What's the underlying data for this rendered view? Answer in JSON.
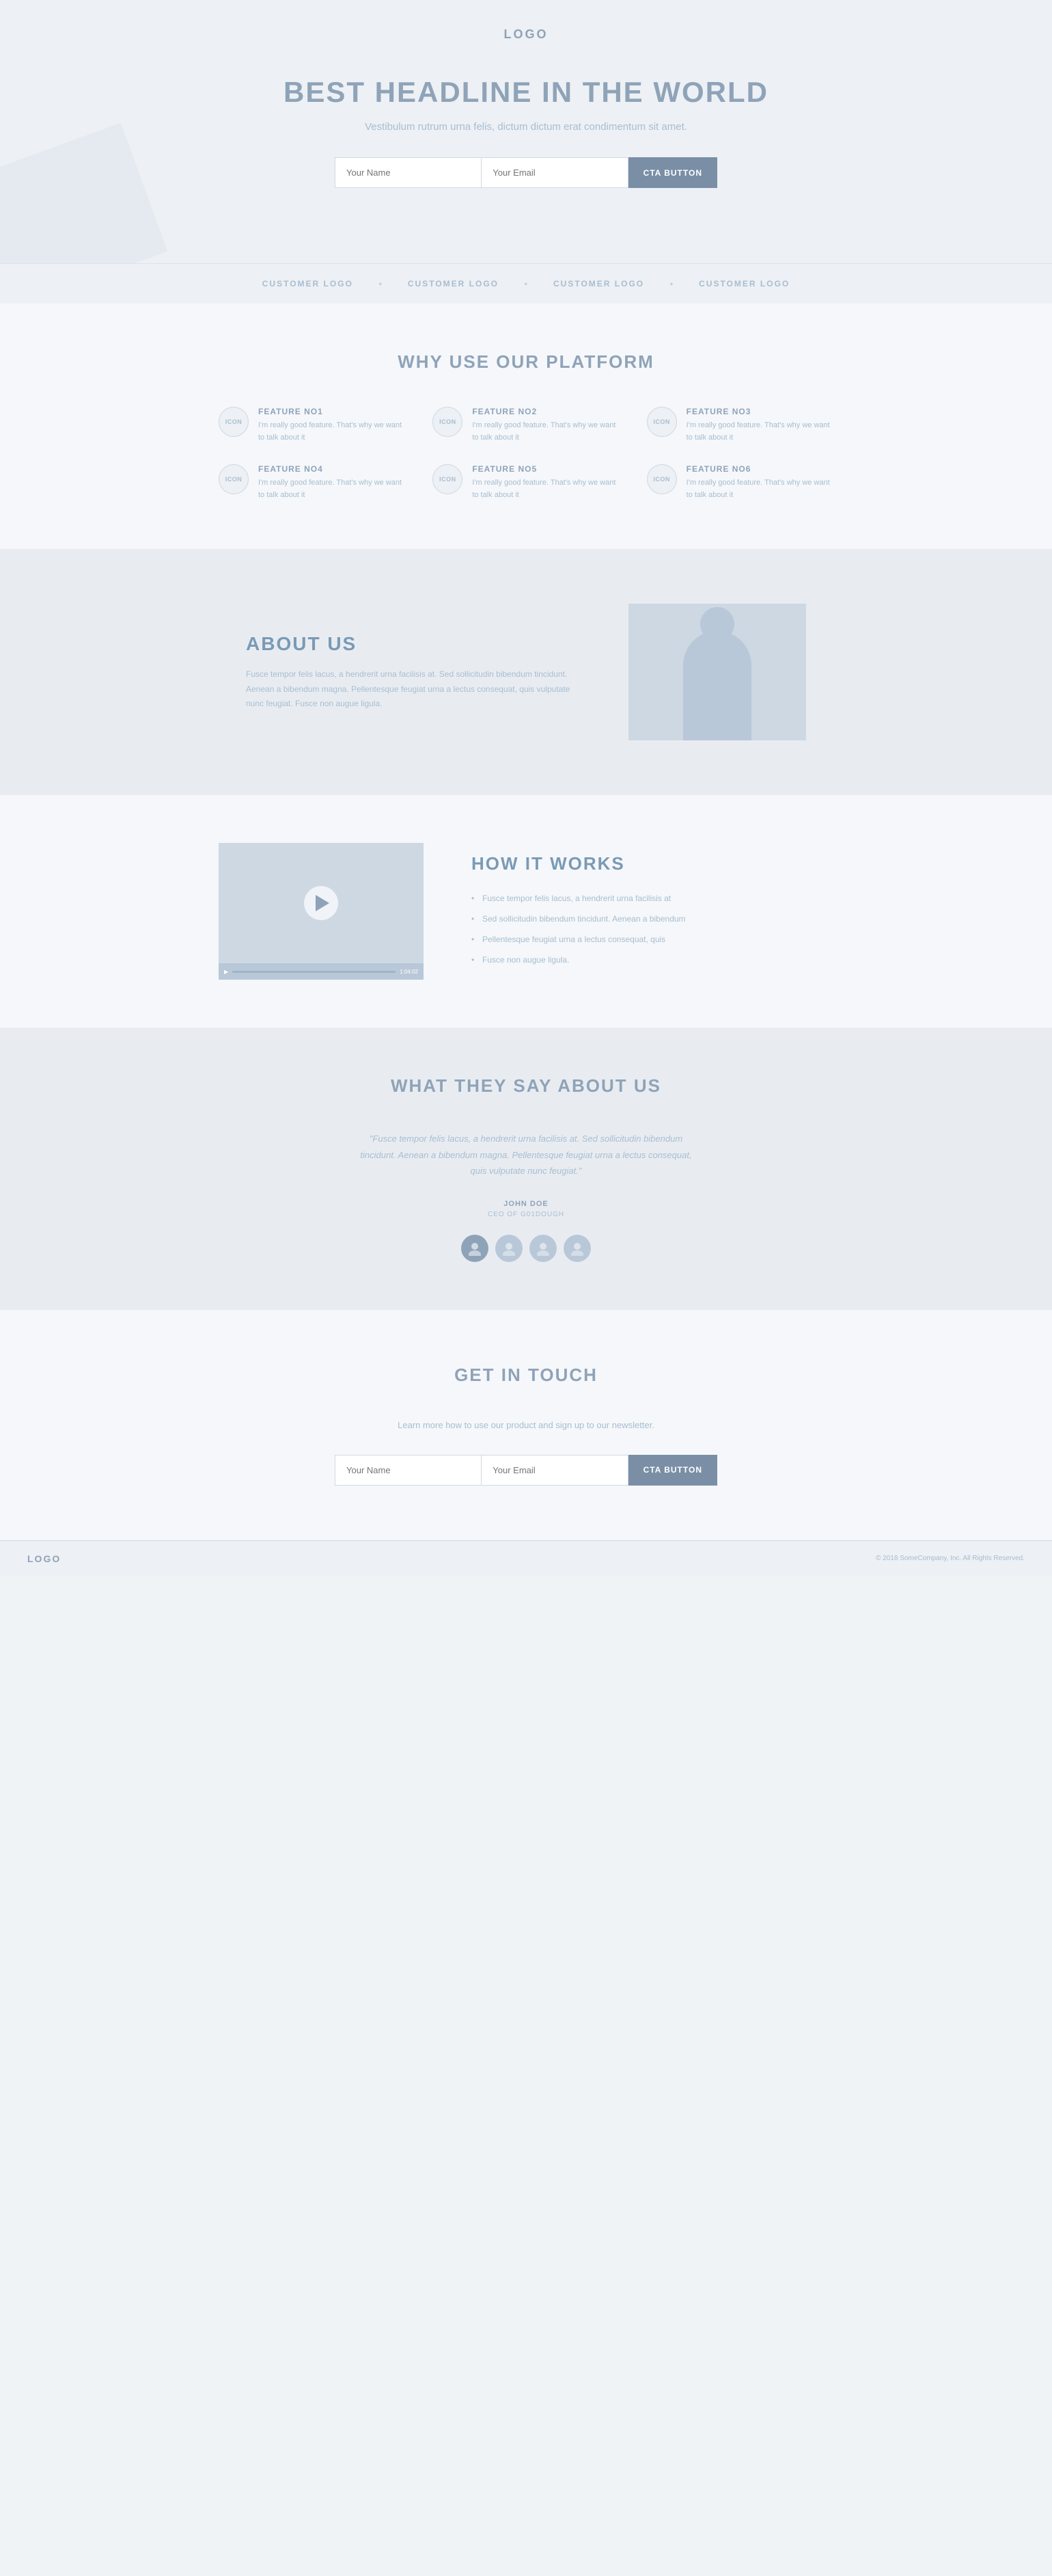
{
  "header": {
    "logo": "LOGO"
  },
  "hero": {
    "headline": "BEST HEADLINE IN THE WORLD",
    "subtext": "Vestibulum rutrum urna felis, dictum dictum erat condimentum sit amet.",
    "name_placeholder": "Your Name",
    "email_placeholder": "Your Email",
    "cta_label": "CTA BUTTON"
  },
  "logos_bar": {
    "items": [
      "CUSTOMER LOGO",
      "CUSTOMER LOGO",
      "CUSTOMER LOGO",
      "CUSTOMER LOGO"
    ]
  },
  "features": {
    "section_title": "WHY USE OUR PLATFORM",
    "items": [
      {
        "icon": "ICON",
        "title": "FEATURE NO1",
        "desc": "I'm really good feature. That's why we want to talk about it"
      },
      {
        "icon": "ICON",
        "title": "FEATURE NO2",
        "desc": "I'm really good feature. That's why we want to talk about it"
      },
      {
        "icon": "ICON",
        "title": "FEATURE NO3",
        "desc": "I'm really good feature. That's why we want to talk about it"
      },
      {
        "icon": "ICON",
        "title": "FEATURE NO4",
        "desc": "I'm really good feature. That's why we want to talk about it"
      },
      {
        "icon": "ICON",
        "title": "FEATURE NO5",
        "desc": "I'm really good feature. That's why we want to talk about it"
      },
      {
        "icon": "ICON",
        "title": "FEATURE NO6",
        "desc": "I'm really good feature. That's why we want to talk about it"
      }
    ]
  },
  "about": {
    "title": "ABOUT US",
    "text": "Fusce tempor felis lacus, a hendrerit urna facilisis at. Sed sollicitudin bibendum tincidunt. Aenean a bibendum magna. Pellentesque feugiat urna a lectus consequat, quis vulputate nunc feugiat. Fusce non augue ligula."
  },
  "howitworks": {
    "title": "HOW IT WORKS",
    "bullets": [
      "Fusce tempor felis lacus, a hendrerit urna facilisis at",
      "Sed sollicitudin bibendum tincidunt. Aenean a bibendum",
      "Pellentesque feugiat urna a lectus consequat, quis",
      "Fusce non augue ligula."
    ],
    "video_time": "1:04:02"
  },
  "testimonials": {
    "section_title": "WHAT THEY SAY ABOUT US",
    "quote": "\"Fusce tempor felis lacus, a hendrerit urna facilisis at. Sed sollicitudin bibendum tincidunt. Aenean a bibendum magna. Pellentesque feugiat urna a lectus consequat, quis vulputate nunc feugiat.\"",
    "author": "JOHN DOE",
    "role": "CEO OF G01DOUGH",
    "avatars": [
      {
        "active": true
      },
      {
        "active": false
      },
      {
        "active": false
      },
      {
        "active": false
      }
    ]
  },
  "contact": {
    "section_title": "GET IN TOUCH",
    "subtitle": "Learn more how to use our product and sign up to our newsletter.",
    "name_placeholder": "Your Name",
    "email_placeholder": "Your Email",
    "cta_label": "CTA BUTTON"
  },
  "footer": {
    "logo": "LOGO",
    "copyright": "© 2018 SomeCompany, Inc. All Rights Reserved."
  }
}
